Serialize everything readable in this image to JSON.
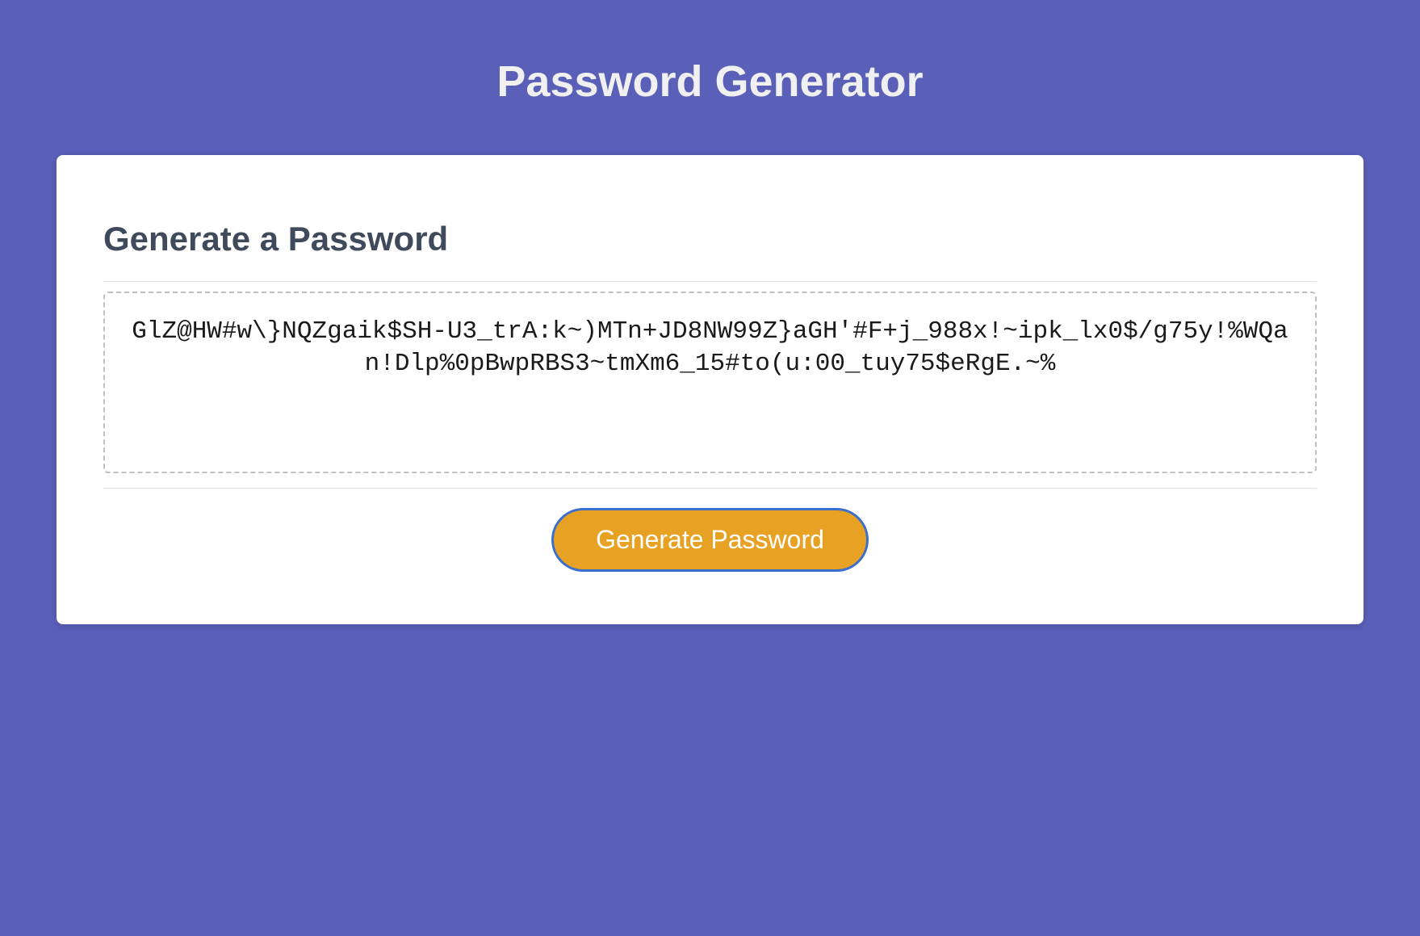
{
  "header": {
    "title": "Password Generator"
  },
  "card": {
    "title": "Generate a Password",
    "password_value": "GlZ@HW#w\\}NQZgaik$SH-U3_trA:k~)MTn+JD8NW99Z}aGH'#F+j_988x!~ipk_lx0$/g75y!%WQan!Dlp%0pBwpRBS3~tmXm6_15#to(u:00_tuy75$eRgE.~%",
    "generate_button_label": "Generate Password"
  },
  "colors": {
    "background": "#5a5fb8",
    "card_bg": "#ffffff",
    "button_bg": "#e8a223",
    "button_border": "#3b6fcc",
    "title_text": "#f0f0f0",
    "card_title_text": "#3f4a5a"
  }
}
